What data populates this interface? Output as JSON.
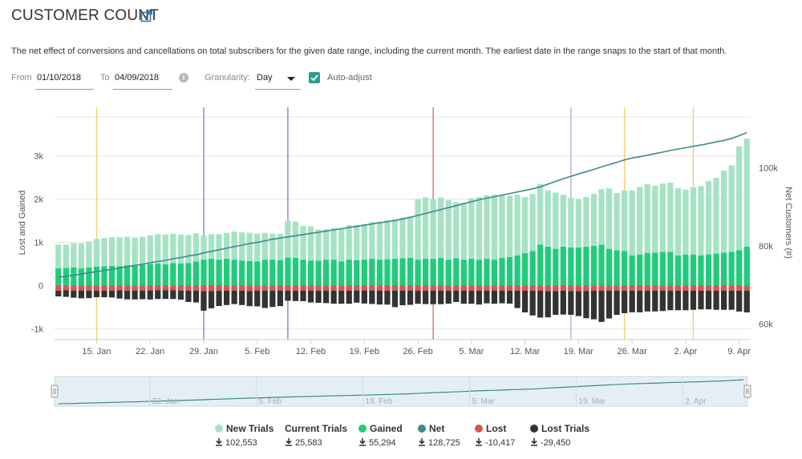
{
  "header": {
    "title": "CUSTOMER COUNT",
    "description": "The net effect of conversions and cancellations on total subscribers for the given date range, including the current month. The earliest date in the range snaps to the start of that month."
  },
  "controls": {
    "from_label": "From",
    "from_value": "01/10/2018",
    "to_label": "To",
    "to_value": "04/09/2018",
    "granularity_label": "Granularity:",
    "granularity_value": "Day",
    "auto_adjust_label": "Auto-adjust",
    "auto_adjust_checked": true
  },
  "colors": {
    "new_trials": "#a6e3c5",
    "gained": "#1fcc7a",
    "lost": "#d9534f",
    "lost_trials": "#333333",
    "net": "#3d8a8d",
    "event_yellow": "#f2d06b",
    "event_purple": "#8c7fc4",
    "event_red": "#e07070",
    "event_lavender": "#b0b0e0"
  },
  "legend": [
    {
      "name": "New Trials",
      "value": "102,553",
      "color": "#a6e3c5"
    },
    {
      "name": "Current Trials",
      "value": "25,583",
      "color": ""
    },
    {
      "name": "Gained",
      "value": "55,294",
      "color": "#1fcc7a"
    },
    {
      "name": "Net",
      "value": "128,725",
      "color": "#3d8a8d"
    },
    {
      "name": "Lost",
      "value": "-10,417",
      "color": "#d9534f"
    },
    {
      "name": "Lost Trials",
      "value": "-29,450",
      "color": "#333333"
    }
  ],
  "chart_data": {
    "type": "bar",
    "ylabel": "Lost and Gained",
    "y2label": "Net Customers (#)",
    "y_ticks": [
      "-1k",
      "0",
      "1k",
      "2k",
      "3k"
    ],
    "y_tick_values": [
      -1000,
      0,
      1000,
      2000,
      3000
    ],
    "y2_ticks": [
      "60k",
      "80k",
      "100k"
    ],
    "y2_tick_values": [
      60000,
      80000,
      100000
    ],
    "ylim": [
      -1250,
      3900
    ],
    "y2lim": [
      56000,
      113000
    ],
    "x_ticks": [
      "15. Jan",
      "22. Jan",
      "29. Jan",
      "5. Feb",
      "12. Feb",
      "19. Feb",
      "26. Feb",
      "5. Mar",
      "12. Mar",
      "19. Mar",
      "26. Mar",
      "2. Apr",
      "9. Apr"
    ],
    "x_tick_days": [
      5,
      12,
      19,
      26,
      33,
      40,
      47,
      54,
      61,
      68,
      75,
      82,
      89
    ],
    "start_date": "2018-01-10",
    "grid": true,
    "event_lines": [
      {
        "day": 5,
        "color": "event_yellow"
      },
      {
        "day": 19,
        "color": "event_purple"
      },
      {
        "day": 30,
        "color": "event_purple"
      },
      {
        "day": 49,
        "color": "event_red"
      },
      {
        "day": 67,
        "color": "event_lavender"
      },
      {
        "day": 74,
        "color": "event_yellow"
      },
      {
        "day": 83,
        "color": "event_yellow"
      }
    ],
    "series": [
      {
        "name": "New Trials",
        "values": [
          550,
          540,
          560,
          580,
          600,
          640,
          650,
          660,
          670,
          660,
          630,
          650,
          660,
          680,
          690,
          680,
          670,
          650,
          650,
          560,
          570,
          590,
          600,
          650,
          650,
          650,
          640,
          620,
          600,
          610,
          850,
          840,
          780,
          790,
          720,
          700,
          730,
          770,
          800,
          810,
          820,
          850,
          880,
          900,
          910,
          940,
          960,
          1400,
          1420,
          1380,
          1400,
          1380,
          1300,
          1320,
          1400,
          1450,
          1470,
          1500,
          1460,
          1420,
          1400,
          1300,
          1320,
          1400,
          1300,
          1300,
          1200,
          1150,
          1120,
          1150,
          1200,
          1280,
          1400,
          1320,
          1400,
          1500,
          1560,
          1600,
          1550,
          1580,
          1600,
          1550,
          1500,
          1550,
          1600,
          1700,
          1750,
          1900,
          2000,
          2400,
          2500
        ]
      },
      {
        "name": "Gained",
        "values": [
          400,
          410,
          420,
          400,
          420,
          440,
          450,
          460,
          450,
          470,
          480,
          480,
          500,
          510,
          490,
          520,
          510,
          520,
          560,
          600,
          620,
          600,
          620,
          600,
          580,
          570,
          560,
          600,
          600,
          590,
          650,
          640,
          600,
          580,
          580,
          600,
          600,
          560,
          600,
          590,
          600,
          620,
          600,
          610,
          620,
          630,
          640,
          600,
          620,
          620,
          640,
          600,
          630,
          600,
          620,
          600,
          620,
          600,
          640,
          660,
          700,
          750,
          800,
          950,
          900,
          850,
          900,
          880,
          880,
          900,
          920,
          950,
          850,
          820,
          800,
          700,
          720,
          750,
          760,
          780,
          780,
          700,
          720,
          720,
          700,
          720,
          740,
          760,
          780,
          820,
          900
        ]
      },
      {
        "name": "Lost",
        "values": [
          -120,
          -110,
          -120,
          -115,
          -120,
          -118,
          -120,
          -115,
          -110,
          -118,
          -120,
          -115,
          -112,
          -110,
          -108,
          -110,
          -115,
          -118,
          -120,
          -130,
          -125,
          -122,
          -120,
          -118,
          -120,
          -125,
          -120,
          -118,
          -115,
          -115,
          -120,
          -118,
          -120,
          -120,
          -118,
          -115,
          -118,
          -120,
          -120,
          -115,
          -115,
          -115,
          -118,
          -120,
          -118,
          -115,
          -115,
          -120,
          -118,
          -120,
          -120,
          -118,
          -120,
          -120,
          -120,
          -118,
          -120,
          -120,
          -120,
          -118,
          -120,
          -120,
          -120,
          -120,
          -125,
          -125,
          -120,
          -125,
          -125,
          -125,
          -120,
          -120,
          -120,
          -118,
          -118,
          -118,
          -118,
          -118,
          -118,
          -118,
          -120,
          -120,
          -120,
          -120,
          -120,
          -120,
          -120,
          -120,
          -120,
          -120,
          -120
        ]
      },
      {
        "name": "Lost Trials",
        "values": [
          -130,
          -150,
          -160,
          -180,
          -170,
          -150,
          -150,
          -160,
          -190,
          -200,
          -200,
          -200,
          -210,
          -200,
          -200,
          -200,
          -210,
          -260,
          -270,
          -450,
          -400,
          -350,
          -330,
          -310,
          -330,
          -350,
          -360,
          -400,
          -380,
          -360,
          -230,
          -240,
          -240,
          -270,
          -280,
          -290,
          -300,
          -300,
          -300,
          -280,
          -300,
          -310,
          -320,
          -320,
          -380,
          -340,
          -330,
          -300,
          -310,
          -310,
          -310,
          -300,
          -260,
          -300,
          -300,
          -320,
          -290,
          -300,
          -290,
          -300,
          -400,
          -500,
          -570,
          -620,
          -610,
          -550,
          -550,
          -550,
          -580,
          -630,
          -660,
          -720,
          -640,
          -560,
          -520,
          -500,
          -500,
          -480,
          -480,
          -470,
          -450,
          -450,
          -450,
          -440,
          -430,
          -430,
          -440,
          -440,
          -440,
          -480,
          -500
        ]
      },
      {
        "name": "Net",
        "values": [
          72000,
          72200,
          72500,
          72800,
          73100,
          73400,
          73700,
          74000,
          74300,
          74700,
          75000,
          75300,
          75700,
          76000,
          76300,
          76700,
          77000,
          77400,
          77700,
          78200,
          78600,
          79000,
          79400,
          79800,
          80200,
          80600,
          80900,
          81300,
          81700,
          82000,
          82300,
          82600,
          82900,
          83200,
          83500,
          83800,
          84100,
          84400,
          84700,
          85000,
          85300,
          85600,
          85900,
          86200,
          86500,
          86900,
          87300,
          87800,
          88300,
          88800,
          89300,
          89800,
          90300,
          90800,
          91300,
          91800,
          92200,
          92600,
          93000,
          93400,
          93800,
          94200,
          94600,
          95100,
          95800,
          96500,
          97200,
          97800,
          98400,
          99000,
          99600,
          100200,
          100800,
          101400,
          102000,
          102500,
          102800,
          103200,
          103600,
          104000,
          104400,
          104800,
          105100,
          105500,
          105800,
          106200,
          106600,
          107000,
          107500,
          108200,
          109000
        ]
      }
    ]
  },
  "navigator": {
    "x_ticks": [
      "22. Jan",
      "5. Feb",
      "19. Feb",
      "5. Mar",
      "19. Mar",
      "2. Apr"
    ],
    "x_tick_days": [
      12,
      26,
      40,
      54,
      68,
      82
    ]
  }
}
